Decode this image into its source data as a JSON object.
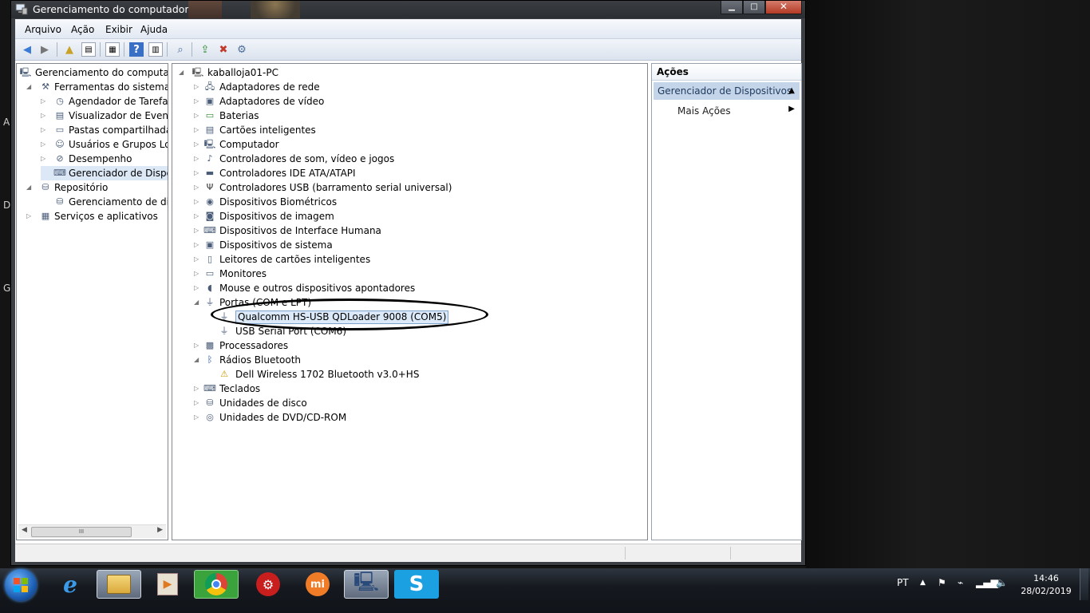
{
  "window": {
    "title": "Gerenciamento do computador"
  },
  "menu": [
    "Arquivo",
    "Ação",
    "Exibir",
    "Ajuda"
  ],
  "left_tree": [
    {
      "label": "Gerenciamento do computado",
      "icon": "computer-management-icon",
      "indent": 0,
      "expander": ""
    },
    {
      "label": "Ferramentas do sistema",
      "icon": "tools-icon",
      "indent": 1,
      "expander": "◢"
    },
    {
      "label": "Agendador de Tarefas",
      "icon": "clock-icon",
      "indent": 2,
      "expander": "▷"
    },
    {
      "label": "Visualizador de Eventos",
      "icon": "event-viewer-icon",
      "indent": 2,
      "expander": "▷"
    },
    {
      "label": "Pastas compartilhadas",
      "icon": "shared-folder-icon",
      "indent": 2,
      "expander": "▷"
    },
    {
      "label": "Usuários e Grupos Loca",
      "icon": "users-icon",
      "indent": 2,
      "expander": "▷"
    },
    {
      "label": "Desempenho",
      "icon": "performance-icon",
      "indent": 2,
      "expander": "▷"
    },
    {
      "label": "Gerenciador de Disposit",
      "icon": "device-manager-icon",
      "indent": 2,
      "expander": "",
      "selected": true
    },
    {
      "label": "Repositório",
      "icon": "storage-icon",
      "indent": 1,
      "expander": "◢"
    },
    {
      "label": "Gerenciamento de disco",
      "icon": "disk-icon",
      "indent": 2,
      "expander": ""
    },
    {
      "label": "Serviços e aplicativos",
      "icon": "services-icon",
      "indent": 1,
      "expander": "▷"
    }
  ],
  "device_tree": {
    "root": "kaballoja01-PC",
    "items": [
      {
        "label": "Adaptadores de rede",
        "icon": "network-adapter-icon",
        "level": 1,
        "expander": "▷"
      },
      {
        "label": "Adaptadores de vídeo",
        "icon": "display-adapter-icon",
        "level": 1,
        "expander": "▷"
      },
      {
        "label": "Baterias",
        "icon": "battery-icon",
        "level": 1,
        "expander": "▷"
      },
      {
        "label": "Cartões inteligentes",
        "icon": "smart-card-icon",
        "level": 1,
        "expander": "▷"
      },
      {
        "label": "Computador",
        "icon": "computer-icon",
        "level": 1,
        "expander": "▷"
      },
      {
        "label": "Controladores de som, vídeo e jogos",
        "icon": "sound-icon",
        "level": 1,
        "expander": "▷"
      },
      {
        "label": "Controladores IDE ATA/ATAPI",
        "icon": "ide-controller-icon",
        "level": 1,
        "expander": "▷"
      },
      {
        "label": "Controladores USB (barramento serial universal)",
        "icon": "usb-icon",
        "level": 1,
        "expander": "▷"
      },
      {
        "label": "Dispositivos Biométricos",
        "icon": "biometric-icon",
        "level": 1,
        "expander": "▷"
      },
      {
        "label": "Dispositivos de imagem",
        "icon": "camera-icon",
        "level": 1,
        "expander": "▷"
      },
      {
        "label": "Dispositivos de Interface Humana",
        "icon": "hid-icon",
        "level": 1,
        "expander": "▷"
      },
      {
        "label": "Dispositivos de sistema",
        "icon": "system-device-icon",
        "level": 1,
        "expander": "▷"
      },
      {
        "label": "Leitores de cartões inteligentes",
        "icon": "card-reader-icon",
        "level": 1,
        "expander": "▷"
      },
      {
        "label": "Monitores",
        "icon": "monitor-icon",
        "level": 1,
        "expander": "▷"
      },
      {
        "label": "Mouse e outros dispositivos apontadores",
        "icon": "mouse-icon",
        "level": 1,
        "expander": "▷"
      },
      {
        "label": "Portas (COM e LPT)",
        "icon": "port-icon",
        "level": 1,
        "expander": "◢"
      },
      {
        "label": "Qualcomm HS-USB QDLoader 9008 (COM5)",
        "icon": "port-device-icon",
        "level": 2,
        "expander": "",
        "selected": true
      },
      {
        "label": "USB Serial Port (COM6)",
        "icon": "port-device-icon",
        "level": 2,
        "expander": ""
      },
      {
        "label": "Processadores",
        "icon": "processor-icon",
        "level": 1,
        "expander": "▷"
      },
      {
        "label": "Rádios Bluetooth",
        "icon": "bluetooth-icon",
        "level": 1,
        "expander": "◢"
      },
      {
        "label": "Dell Wireless 1702 Bluetooth v3.0+HS",
        "icon": "bluetooth-warning-icon",
        "level": 2,
        "expander": ""
      },
      {
        "label": "Teclados",
        "icon": "keyboard-icon",
        "level": 1,
        "expander": "▷"
      },
      {
        "label": "Unidades de disco",
        "icon": "disk-drive-icon",
        "level": 1,
        "expander": "▷"
      },
      {
        "label": "Unidades de DVD/CD-ROM",
        "icon": "dvd-icon",
        "level": 1,
        "expander": "▷"
      }
    ]
  },
  "actions": {
    "title": "Ações",
    "section": "Gerenciador de Dispositivos",
    "more": "Mais Ações"
  },
  "taskbar": {
    "apps": [
      "internet-explorer-icon",
      "file-explorer-icon",
      "media-player-icon",
      "chrome-icon",
      "red-app-icon",
      "mi-app-icon",
      "computer-management-icon",
      "skype-icon"
    ],
    "language": "PT",
    "time": "14:46",
    "date": "28/02/2019"
  }
}
